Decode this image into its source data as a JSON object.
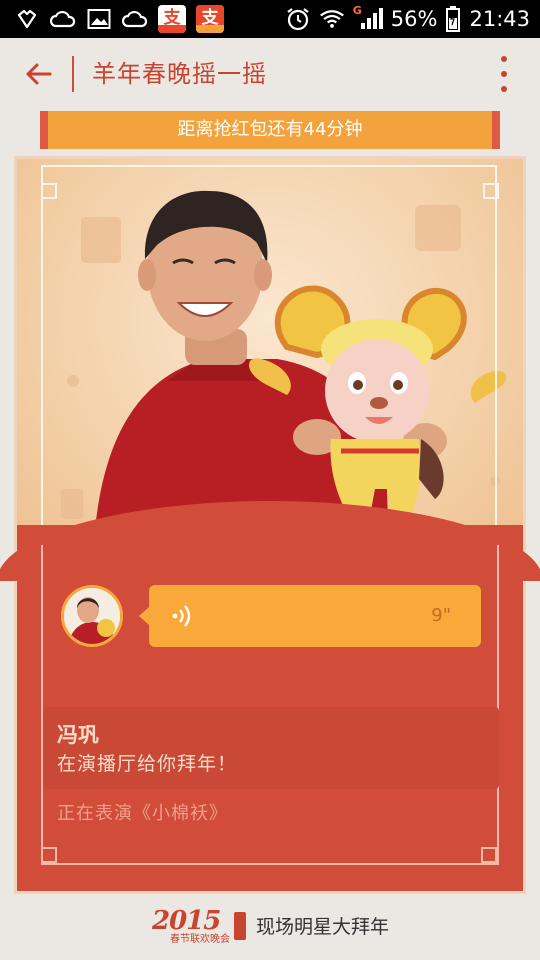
{
  "status_bar": {
    "battery": "56%",
    "time": "21:43",
    "signal_tag": "G",
    "icons": [
      "qq-icon",
      "cloud-icon",
      "gallery-icon",
      "cloud-icon",
      "alipay-icon",
      "alipay-icon",
      "alarm-icon",
      "wifi-icon",
      "signal-icon",
      "battery-icon"
    ]
  },
  "app_bar": {
    "title": "羊年春晚摇一摇",
    "back_icon": "back-arrow-icon",
    "more_icon": "more-vertical-icon"
  },
  "countdown": {
    "text": "距离抢红包还有44分钟"
  },
  "card": {
    "voice_message": {
      "duration": "9\""
    },
    "star_name": "冯巩",
    "greeting": "在演播厅给你拜年！",
    "performing": "正在表演《小棉袄》"
  },
  "footer": {
    "logo_year": "2015",
    "logo_caption": "春节联欢晚会",
    "tagline": "现场明星大拜年"
  },
  "colors": {
    "accent_red": "#d14c39",
    "accent_orange": "#f8a93a",
    "title_red": "#c9442f"
  }
}
